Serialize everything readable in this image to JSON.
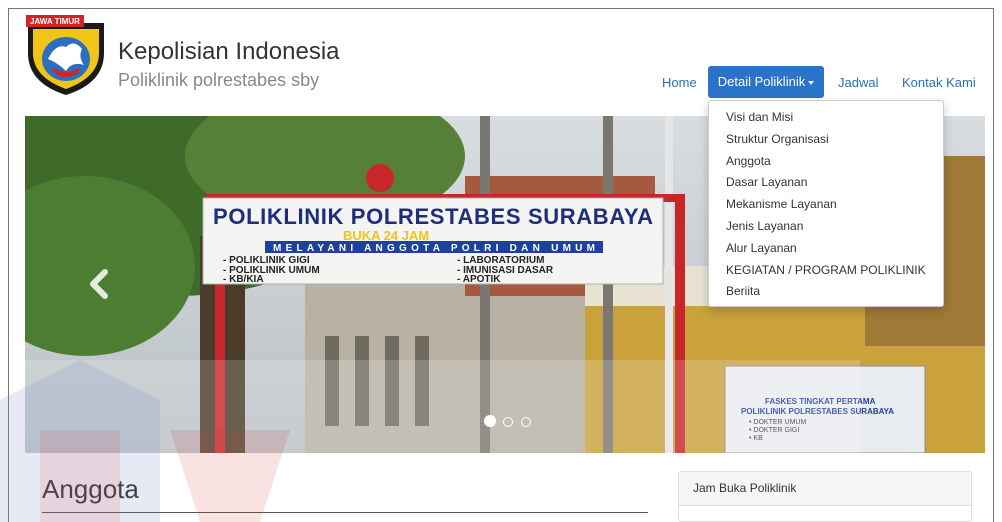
{
  "brand": {
    "badge_text": "JAWA TIMUR",
    "title": "Kepolisian Indonesia",
    "subtitle": "Poliklinik polrestabes sby"
  },
  "nav": {
    "home": "Home",
    "detail": "Detail Poliklinik",
    "jadwal": "Jadwal",
    "kontak": "Kontak Kami"
  },
  "dropdown": {
    "items": [
      "Visi dan Misi",
      "Struktur Organisasi",
      "Anggota",
      "Dasar Layanan",
      "Mekanisme Layanan",
      "Jenis Layanan",
      "Alur Layanan",
      "KEGIATAN / PROGRAM POLIKLINIK",
      "Beriita"
    ]
  },
  "carousel": {
    "sign_title": "POLIKLINIK POLRESTABES SURABAYA",
    "sign_hours": "BUKA 24 JAM",
    "sign_banner": "MELAYANI ANGGOTA POLRI DAN UMUM",
    "sign_col1": [
      "- POLIKLINIK GIGI",
      "- POLIKLINIK UMUM",
      "- KB/KIA"
    ],
    "sign_col2": [
      "- LABORATORIUM",
      "- IMUNISASI DASAR",
      "- APOTIK"
    ],
    "board_title": "FASKES TINGKAT PERTAMA",
    "board_sub": "POLIKLINIK POLRESTABES SURABAYA",
    "board_items": [
      "• DOKTER UMUM",
      "• DOKTER GIGI",
      "• KB"
    ],
    "slide_count": 3,
    "active_slide": 1
  },
  "section": {
    "title": "Anggota"
  },
  "panel": {
    "title": "Jam Buka Poliklinik"
  },
  "colors": {
    "nav_active": "#2a73c8",
    "link": "#2a6fb0",
    "sign_red": "#d0262a"
  }
}
